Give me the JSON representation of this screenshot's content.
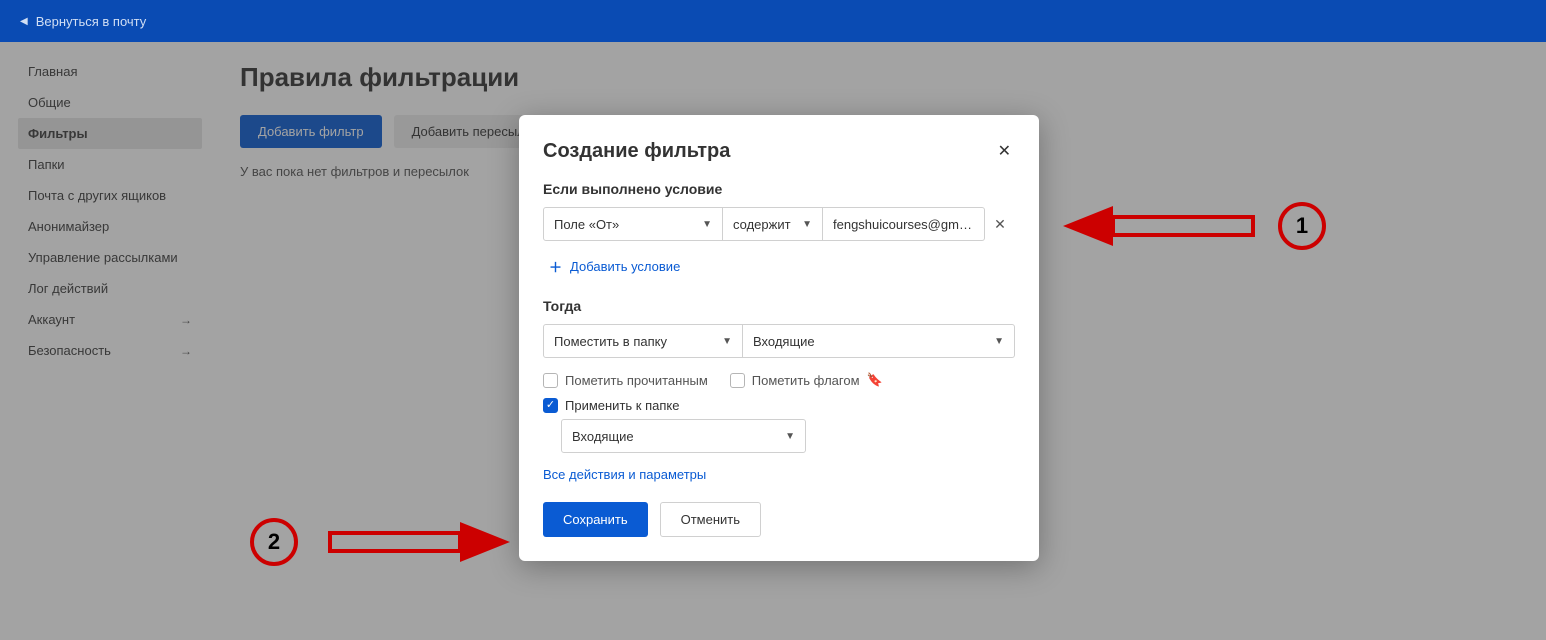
{
  "topbar": {
    "back_label": "Вернуться в почту"
  },
  "sidebar": {
    "items": [
      {
        "label": "Главная",
        "active": false,
        "has_chev": false
      },
      {
        "label": "Общие",
        "active": false,
        "has_chev": false
      },
      {
        "label": "Фильтры",
        "active": true,
        "has_chev": false
      },
      {
        "label": "Папки",
        "active": false,
        "has_chev": false
      },
      {
        "label": "Почта с других ящиков",
        "active": false,
        "has_chev": false
      },
      {
        "label": "Анонимайзер",
        "active": false,
        "has_chev": false
      },
      {
        "label": "Управление рассылками",
        "active": false,
        "has_chev": false
      },
      {
        "label": "Лог действий",
        "active": false,
        "has_chev": false
      },
      {
        "label": "Аккаунт",
        "active": false,
        "has_chev": true
      },
      {
        "label": "Безопасность",
        "active": false,
        "has_chev": true
      }
    ]
  },
  "main": {
    "title": "Правила фильтрации",
    "add_filter_label": "Добавить фильтр",
    "add_forward_label": "Добавить пересылку",
    "empty_text": "У вас пока нет фильтров и пересылок"
  },
  "modal": {
    "title": "Создание фильтра",
    "section_condition": "Если выполнено условие",
    "condition": {
      "field": "Поле «От»",
      "operator": "содержит",
      "value": "fengshuicourses@gmail.com"
    },
    "add_condition_label": "Добавить условие",
    "section_then": "Тогда",
    "then": {
      "action": "Поместить в папку",
      "folder": "Входящие"
    },
    "check_mark_read": "Пометить прочитанным",
    "check_flag": "Пометить флагом",
    "check_apply_folder": "Применить к папке",
    "apply_folder_value": "Входящие",
    "all_params_label": "Все действия и параметры",
    "save_label": "Сохранить",
    "cancel_label": "Отменить"
  },
  "annotations": {
    "num1": "1",
    "num2": "2"
  }
}
